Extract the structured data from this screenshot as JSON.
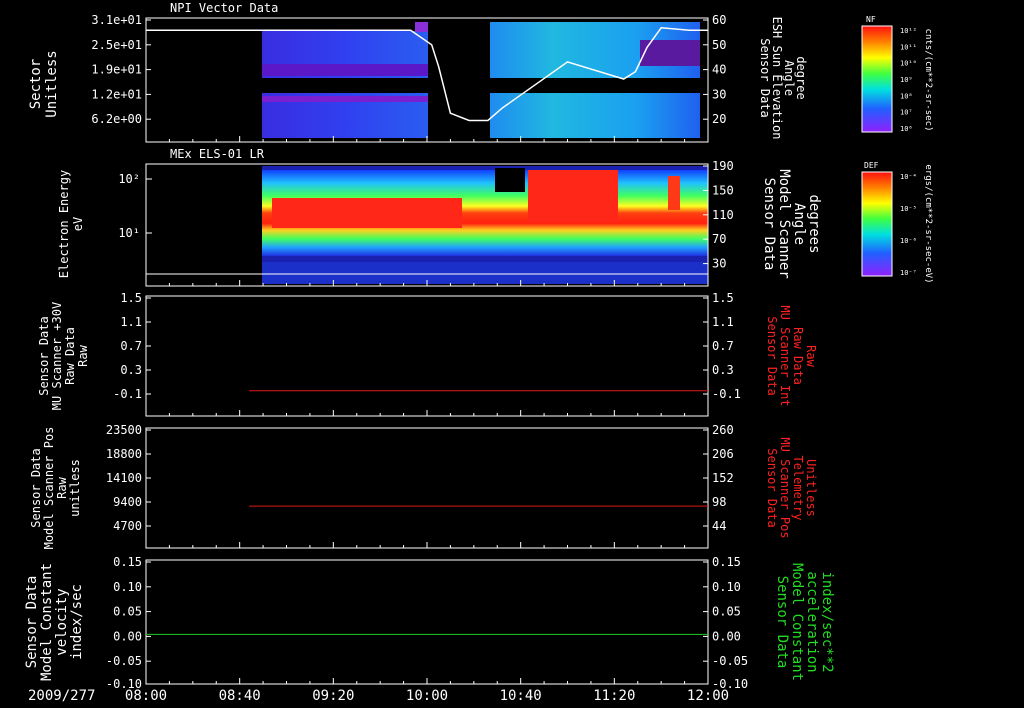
{
  "chart_data": [
    {
      "type": "heatmap",
      "title": "NPI Vector Data",
      "ylabel": [
        "Sector",
        "Unitless"
      ],
      "y_ticks": [
        "3.1e+01",
        "2.5e+01",
        "1.9e+01",
        "1.2e+01",
        "6.2e+00"
      ],
      "ylabel_right": [
        "Sensor Data",
        "ESH Sun Elevation",
        "Angle",
        "degree"
      ],
      "y2_ticks": [
        "60",
        "50",
        "40",
        "30",
        "20"
      ],
      "y2lim": [
        10,
        60
      ],
      "overlay_line": {
        "name": "ESH Sun Elevation Angle",
        "x": [
          "08:00",
          "08:46",
          "09:20",
          "09:53",
          "10:02",
          "10:05",
          "10:10",
          "10:18",
          "10:26",
          "10:32",
          "11:00",
          "11:24",
          "11:29",
          "11:34",
          "11:40",
          "11:52",
          "12:00"
        ],
        "y": [
          55,
          55,
          55,
          55,
          49,
          40,
          21,
          18,
          18,
          23,
          42,
          35,
          38,
          48,
          56,
          55,
          55
        ]
      },
      "colorbar": {
        "label": "cnts/(cm**2-sr-sec)",
        "tag": "NF",
        "ticks": [
          "10¹²",
          "10¹¹",
          "10¹⁰",
          "10⁹",
          "10⁸",
          "10⁷",
          "10⁶"
        ]
      }
    },
    {
      "type": "heatmap",
      "title": "MEx ELS-01 LR",
      "ylabel": [
        "Electron Energy",
        "eV"
      ],
      "y_ticks": [
        "10²",
        "10¹"
      ],
      "ylabel_right": [
        "Sensor Data",
        "Model Scanner",
        "Angle",
        "degrees"
      ],
      "y2_ticks": [
        "190",
        "150",
        "110",
        "70",
        "30"
      ],
      "y2lim": [
        0,
        190
      ],
      "overlay_line": {
        "name": "Model Scanner Angle",
        "x": [
          "08:00",
          "12:00"
        ],
        "y": [
          12,
          12
        ]
      },
      "colorbar": {
        "label": "ergs/(cm**2-sr-sec-eV)",
        "tag": "DEF",
        "ticks": [
          "10⁻⁴",
          "10⁻⁵",
          "10⁻⁶",
          "10⁻⁷"
        ]
      }
    },
    {
      "type": "line",
      "ylabel": [
        "Sensor Data",
        "MU Scanner +30V",
        "Raw Data",
        "Raw"
      ],
      "y_ticks": [
        "1.5",
        "1.1",
        "0.7",
        "0.3",
        "-0.1"
      ],
      "ylim": [
        -0.4,
        1.5
      ],
      "ylabel_right": [
        "Sensor Data",
        "MU Scanner Int",
        "Raw Data",
        "Raw"
      ],
      "y2_ticks": [
        "1.5",
        "1.1",
        "0.7",
        "0.3",
        "-0.1"
      ],
      "series": [
        {
          "color": "#e01818",
          "x": [
            "08:44",
            "12:00"
          ],
          "y": [
            0.0,
            0.0
          ]
        }
      ]
    },
    {
      "type": "line",
      "ylabel": [
        "Sensor Data",
        "Model Scanner Pos",
        "Raw",
        "unitless"
      ],
      "y_ticks": [
        "23500",
        "18800",
        "14100",
        "9400",
        "4700"
      ],
      "ylim": [
        0,
        23500
      ],
      "ylabel_right": [
        "Sensor Data",
        "MU Scanner Pos",
        "Telemetry",
        "Unitless"
      ],
      "y2_ticks": [
        "260",
        "206",
        "152",
        "98",
        "44"
      ],
      "series": [
        {
          "color": "#e01818",
          "x": [
            "08:44",
            "12:00"
          ],
          "y": [
            8200,
            8200
          ]
        }
      ]
    },
    {
      "type": "line",
      "ylabel": [
        "Sensor Data",
        "Model Constant",
        "velocity",
        "index/sec"
      ],
      "y_ticks": [
        "0.15",
        "0.10",
        "0.05",
        "0.00",
        "-0.05",
        "-0.10"
      ],
      "ylim": [
        -0.1,
        0.15
      ],
      "ylabel_right": [
        "Sensor Data",
        "Model Constant",
        "acceleration",
        "index/sec**2"
      ],
      "y2_ticks": [
        "0.15",
        "0.10",
        "0.05",
        "0.00",
        "-0.05",
        "-0.10"
      ],
      "series": [
        {
          "color": "#22cc22",
          "x": [
            "08:00",
            "12:00"
          ],
          "y": [
            0.0,
            0.0
          ]
        }
      ]
    }
  ],
  "x_axis": {
    "date": "2009/277",
    "ticks": [
      "08:00",
      "08:40",
      "09:20",
      "10:00",
      "10:40",
      "11:20",
      "12:00"
    ],
    "xlim": [
      "08:00",
      "12:00"
    ]
  }
}
